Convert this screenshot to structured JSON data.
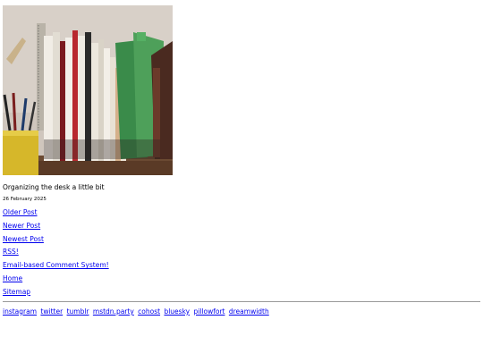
{
  "post": {
    "image_alt": "Organizing the desk a little bit",
    "caption": "Organizing the desk a little bit",
    "date": "26 February 2025"
  },
  "nav": [
    "Older Post",
    "Newer Post",
    "Newest Post",
    "RSS!",
    "Email-based Comment System!",
    "Home",
    "Sitemap"
  ],
  "social": [
    "instagram",
    "twitter",
    "tumblr",
    "mstdn.party",
    "cohost",
    "bluesky",
    "pillowfort",
    "dreamwidth"
  ],
  "colors": {
    "link": "#0000ee",
    "rule": "#999999"
  }
}
